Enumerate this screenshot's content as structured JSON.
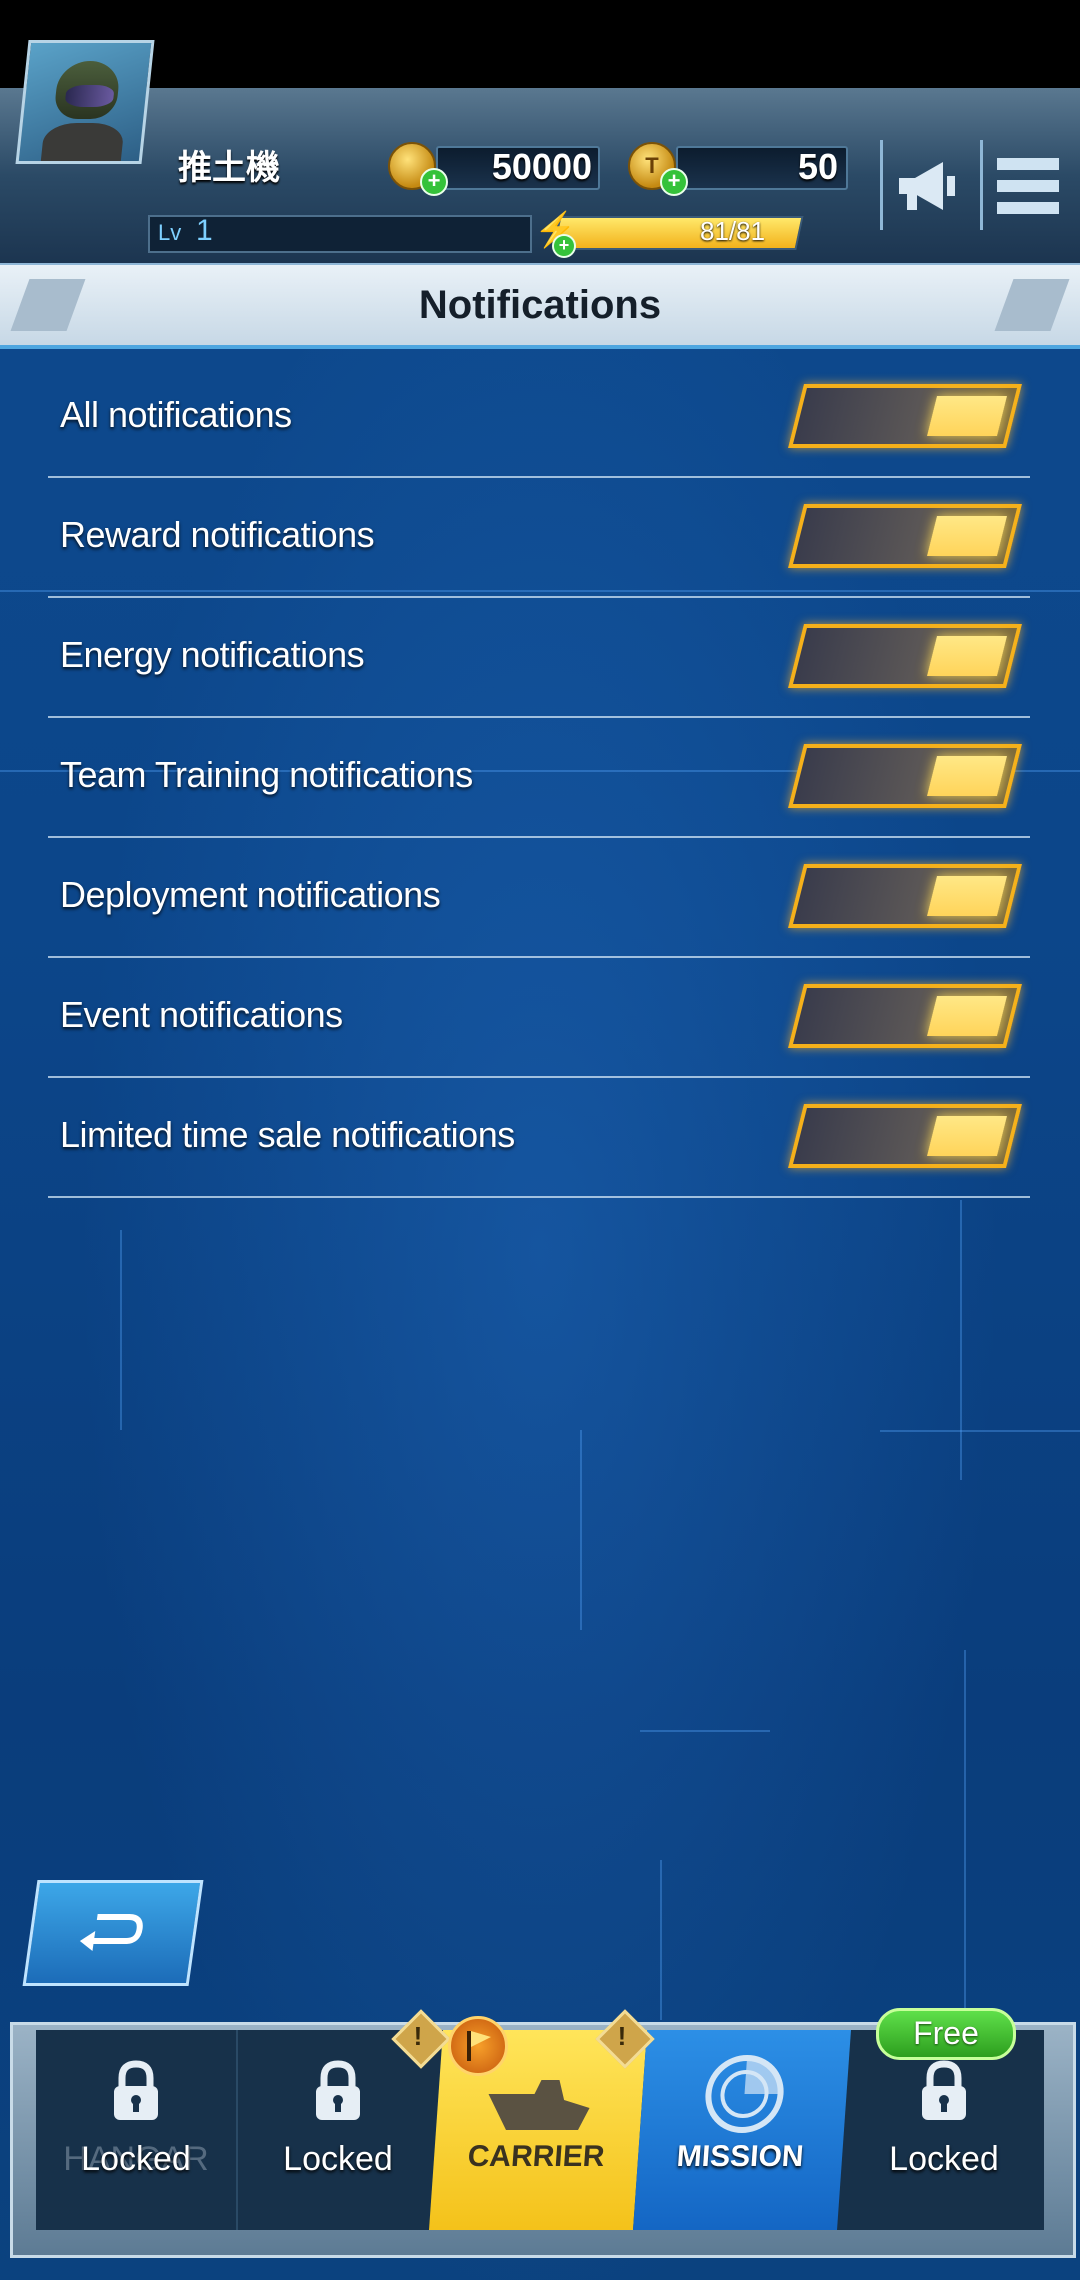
{
  "header": {
    "player_name": "推土機",
    "level_label": "Lv",
    "level_value": "1",
    "coins": "50000",
    "tickets": "50",
    "coin_icon_letter": "",
    "ticket_icon_letter": "T",
    "energy": "81/81",
    "energy_fraction": 1.0
  },
  "page": {
    "title": "Notifications"
  },
  "settings": [
    {
      "label": "All notifications",
      "enabled": true
    },
    {
      "label": "Reward notifications",
      "enabled": true
    },
    {
      "label": "Energy notifications",
      "enabled": true
    },
    {
      "label": "Team Training notifications",
      "enabled": true
    },
    {
      "label": "Deployment notifications",
      "enabled": true
    },
    {
      "label": "Event notifications",
      "enabled": true
    },
    {
      "label": "Limited time sale notifications",
      "enabled": true
    }
  ],
  "nav": {
    "tab1_label": "Locked",
    "tab1_ghost": "HANGAR",
    "tab2_label": "Locked",
    "tab3_label": "CARRIER",
    "tab4_label": "MISSION",
    "tab5_label": "Locked",
    "free_badge": "Free",
    "alert_mark": "!"
  },
  "colors": {
    "accent": "#f5b01a",
    "toggle_on": "#ffd45a",
    "background": "#0c468a"
  }
}
